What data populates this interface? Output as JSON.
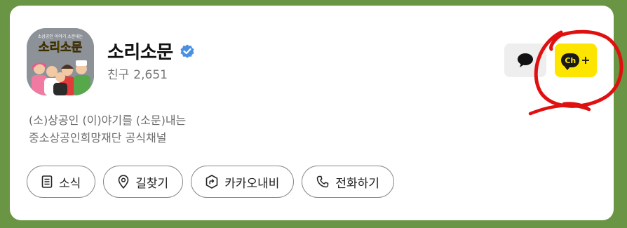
{
  "channel": {
    "name": "소리소문",
    "friends_label": "친구",
    "friends_count": "2,651",
    "description_lines": [
      "(소)상공인 (이)야기를 (소문)내는",
      "중소상공인희망재단 공식채널"
    ],
    "avatar": {
      "tagline": "소상공인 이야기 소문내는",
      "logo_text": "소리소문"
    }
  },
  "header_buttons": {
    "chat_icon": "speech-bubble-icon",
    "add_channel_label": "Ch",
    "add_channel_plus": "+"
  },
  "actions": [
    {
      "label": "소식",
      "icon": "document-icon"
    },
    {
      "label": "길찾기",
      "icon": "location-pin-icon"
    },
    {
      "label": "카카오내비",
      "icon": "navi-icon"
    },
    {
      "label": "전화하기",
      "icon": "phone-icon"
    }
  ],
  "colors": {
    "background": "#6a9545",
    "card": "#ffffff",
    "verified": "#4a90e2",
    "channel_add": "#fee500",
    "annotation": "#e01010"
  }
}
